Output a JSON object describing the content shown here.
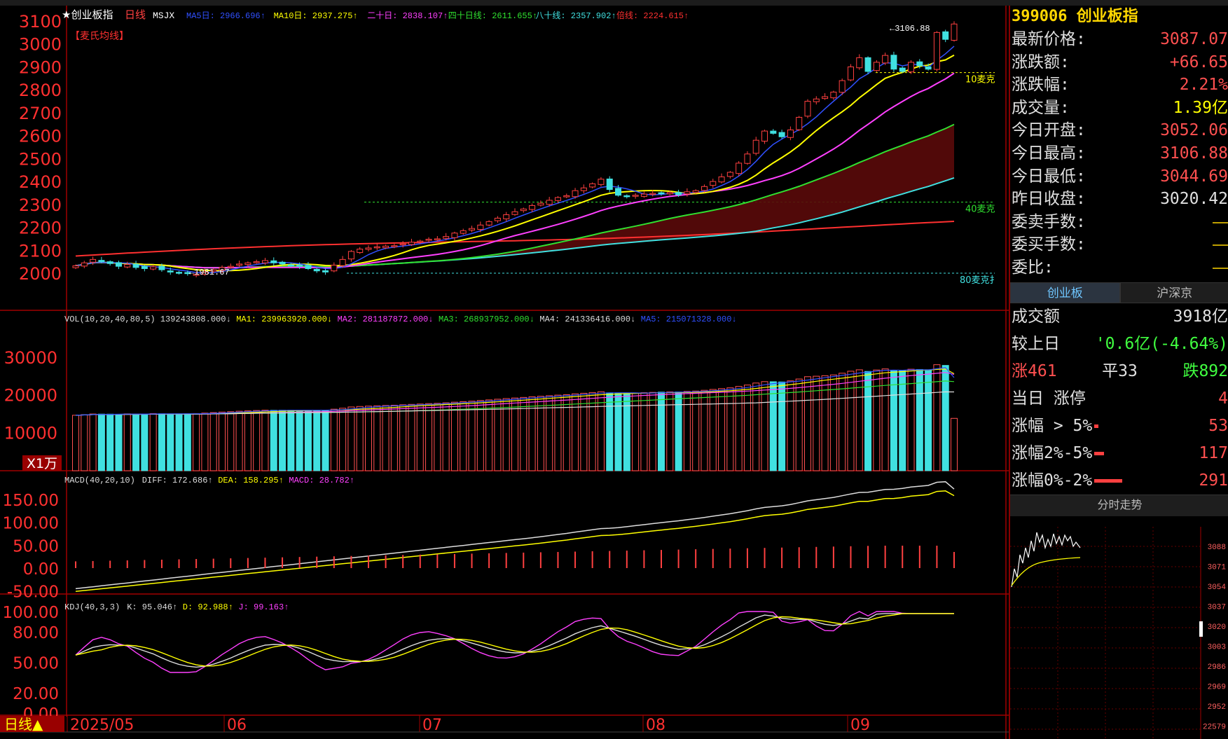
{
  "main": {
    "title": "★创业板指",
    "period": "日线",
    "indicator": "MSJX",
    "ma_legend": [
      {
        "label": "MA5日:",
        "value": "2966.696",
        "color": "#3050ff"
      },
      {
        "label": "MA10日:",
        "value": "2937.275",
        "color": "#ffff00"
      },
      {
        "label": "二十日:",
        "value": "2838.107",
        "color": "#ff40ff"
      },
      {
        "label": "四十日线:",
        "value": "2611.655",
        "color": "#30e030"
      },
      {
        "label": "八十线:",
        "value": "2357.902",
        "color": "#40e0e0"
      },
      {
        "label": "倍线:",
        "value": "2224.615",
        "color": "#ff3030"
      }
    ],
    "subtitle": "【麦氏均线】",
    "y_ticks": [
      "3100",
      "3000",
      "2900",
      "2800",
      "2700",
      "2600",
      "2500",
      "2400",
      "2300",
      "2200",
      "2100",
      "2000"
    ],
    "annotations": {
      "high": "3106.88",
      "low": "1981.67",
      "mk10": "10麦克",
      "mk40": "40麦克",
      "mk80": "80麦克扌"
    }
  },
  "volume": {
    "legend": [
      {
        "label": "VOL(10,20,40,80,5)",
        "value": "139243808.000",
        "color": "#dddddd"
      },
      {
        "label": "MA1:",
        "value": "239963920.000",
        "color": "#ffff00"
      },
      {
        "label": "MA2:",
        "value": "281187872.000",
        "color": "#ff40ff"
      },
      {
        "label": "MA3:",
        "value": "268937952.000",
        "color": "#30e030"
      },
      {
        "label": "MA4:",
        "value": "241336416.000",
        "color": "#dddddd"
      },
      {
        "label": "MA5:",
        "value": "215071328.000",
        "color": "#3050ff"
      }
    ],
    "y_ticks": [
      "30000",
      "20000",
      "10000"
    ],
    "unit": "X1万"
  },
  "macd": {
    "legend": [
      {
        "label": "MACD(40,20,10)",
        "value": "",
        "color": "#dddddd"
      },
      {
        "label": "DIFF:",
        "value": "172.686",
        "color": "#dddddd"
      },
      {
        "label": "DEA:",
        "value": "158.295",
        "color": "#ffff00"
      },
      {
        "label": "MACD:",
        "value": "28.782",
        "color": "#ff40ff"
      }
    ],
    "y_ticks": [
      "150.00",
      "100.00",
      "50.00",
      "0.00",
      "-50.00"
    ]
  },
  "kdj": {
    "legend": [
      {
        "label": "KDJ(40,3,3)",
        "value": "",
        "color": "#dddddd"
      },
      {
        "label": "K:",
        "value": "95.046",
        "color": "#dddddd"
      },
      {
        "label": "D:",
        "value": "92.988",
        "color": "#ffff00"
      },
      {
        "label": "J:",
        "value": "99.163",
        "color": "#ff40ff"
      }
    ],
    "y_ticks": [
      "100.00",
      "80.00",
      "50.00",
      "20.00",
      "0.00"
    ]
  },
  "date_axis": {
    "period_badge": "日线▲",
    "labels": [
      "2025/05",
      "06",
      "07",
      "08",
      "09"
    ]
  },
  "quote": {
    "code": "399006",
    "name": "创业板指",
    "rows": [
      {
        "label": "最新价格:",
        "value": "3087.07",
        "color": "#ff5050"
      },
      {
        "label": "涨跌额:",
        "value": "+66.65",
        "color": "#ff5050"
      },
      {
        "label": "涨跌幅:",
        "value": "2.21%",
        "color": "#ff5050"
      },
      {
        "label": "成交量:",
        "value": "1.39亿",
        "color": "#ffff00"
      },
      {
        "label": "今日开盘:",
        "value": "3052.06",
        "color": "#ff5050"
      },
      {
        "label": "今日最高:",
        "value": "3106.88",
        "color": "#ff5050"
      },
      {
        "label": "今日最低:",
        "value": "3044.69",
        "color": "#ff5050"
      },
      {
        "label": "昨日收盘:",
        "value": "3020.42",
        "color": "#e0e0e0"
      },
      {
        "label": "委卖手数:",
        "value": "",
        "color": "#e0e0e0"
      },
      {
        "label": "委买手数:",
        "value": "",
        "color": "#e0e0e0"
      },
      {
        "label": "委比:",
        "value": "",
        "color": "#e0e0e0"
      }
    ],
    "tabs": [
      "创业板",
      "沪深京"
    ]
  },
  "breadth": {
    "turnover_label": "成交额",
    "turnover_value": "3918亿",
    "vs_prev_label": "较上日",
    "vs_prev_value": "'0.6亿(-4.64%)",
    "up": "涨461",
    "flat": "平33",
    "down": "跌892",
    "limit_label": "当日 涨停",
    "limit_value": "4",
    "gt5_label": "涨幅 > 5%",
    "gt5_value": "53",
    "r2_5_label": "涨幅2%-5%",
    "r2_5_value": "117",
    "r0_2_label": "涨幅0%-2%",
    "r0_2_value": "291"
  },
  "intraday": {
    "title": "分时走势",
    "y_labels": [
      "3088",
      "3071",
      "3054",
      "3037",
      "3020",
      "3003",
      "2986",
      "2969",
      "2952",
      "22579"
    ]
  },
  "chart_data": {
    "type": "candlestick",
    "title": "创业板指 日线",
    "x_labels": [
      "2025/05",
      "06",
      "07",
      "08",
      "09"
    ],
    "ylim": [
      1960,
      3130
    ],
    "closes": [
      2032,
      2045,
      2060,
      2050,
      2042,
      2030,
      2038,
      2025,
      2020,
      2028,
      2015,
      2005,
      2000,
      1998,
      1995,
      2005,
      2015,
      2025,
      2030,
      2040,
      2045,
      2050,
      2055,
      2045,
      2040,
      2035,
      2030,
      2020,
      2010,
      2005,
      2035,
      2060,
      2095,
      2105,
      2110,
      2115,
      2118,
      2120,
      2128,
      2135,
      2140,
      2148,
      2150,
      2160,
      2175,
      2185,
      2195,
      2210,
      2225,
      2240,
      2255,
      2268,
      2280,
      2295,
      2305,
      2318,
      2330,
      2338,
      2360,
      2372,
      2390,
      2410,
      2365,
      2340,
      2335,
      2340,
      2345,
      2348,
      2350,
      2352,
      2342,
      2355,
      2360,
      2378,
      2400,
      2420,
      2440,
      2480,
      2520,
      2580,
      2620,
      2610,
      2595,
      2625,
      2680,
      2750,
      2760,
      2770,
      2790,
      2840,
      2900,
      2940,
      2880,
      2920,
      2950,
      2890,
      2880,
      2920,
      2905,
      2890,
      3050,
      3020,
      3087
    ]
  }
}
